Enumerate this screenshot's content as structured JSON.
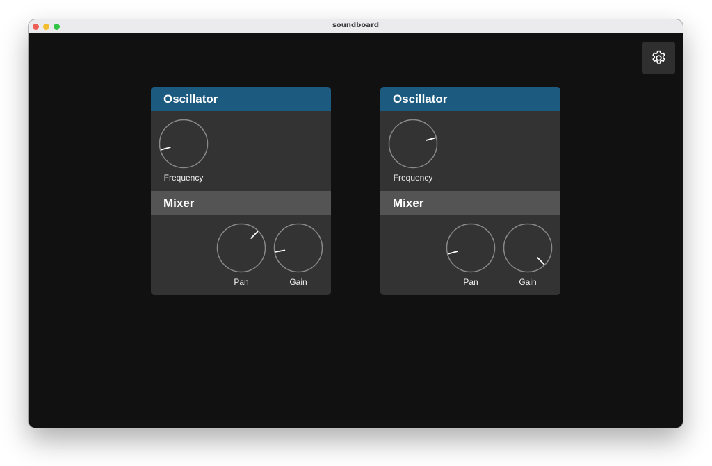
{
  "window": {
    "title": "soundboard"
  },
  "settings": {
    "icon": "gear-icon"
  },
  "colors": {
    "background": "#111111",
    "panel": "#333333",
    "oscillator_header": "#1c5a80",
    "mixer_header": "#545454",
    "knob_ring": "#8a8a8a",
    "knob_pointer": "#ffffff"
  },
  "modules": [
    {
      "oscillator": {
        "title": "Oscillator",
        "frequency": {
          "label": "Frequency",
          "angle_deg": 255
        }
      },
      "mixer": {
        "title": "Mixer",
        "pan": {
          "label": "Pan",
          "angle_deg": 45
        },
        "gain": {
          "label": "Gain",
          "angle_deg": 260
        }
      }
    },
    {
      "oscillator": {
        "title": "Oscillator",
        "frequency": {
          "label": "Frequency",
          "angle_deg": 75
        }
      },
      "mixer": {
        "title": "Mixer",
        "pan": {
          "label": "Pan",
          "angle_deg": 255
        },
        "gain": {
          "label": "Gain",
          "angle_deg": 135
        }
      }
    }
  ]
}
